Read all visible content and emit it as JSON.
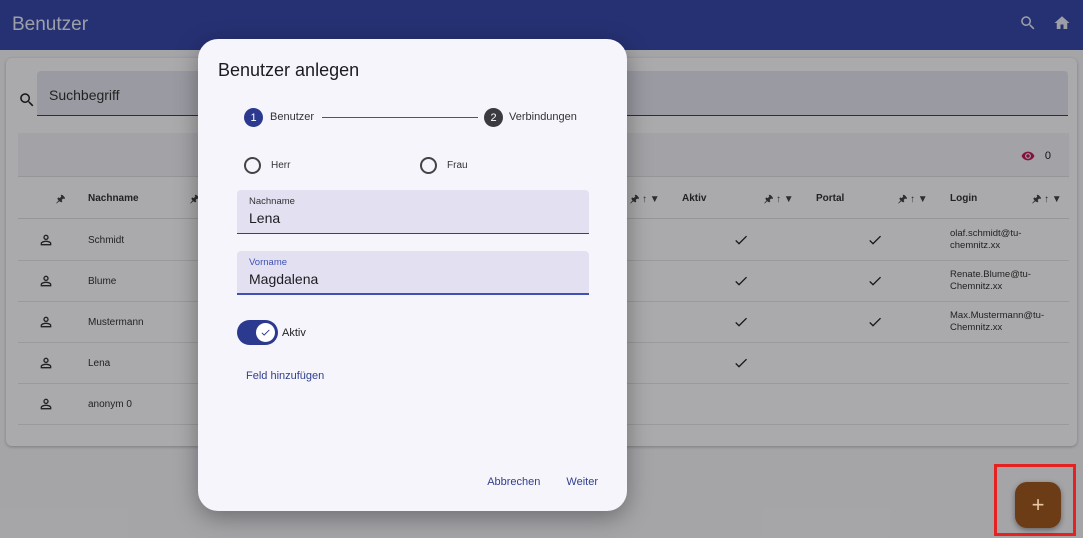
{
  "appbar": {
    "title": "Benutzer",
    "icons": [
      "search-icon",
      "home-icon"
    ]
  },
  "search": {
    "placeholder": "Suchbegriff"
  },
  "table": {
    "view_count": "0",
    "columns": {
      "nachname": "Nachname",
      "aktiv": "Aktiv",
      "portal": "Portal",
      "login": "Login"
    },
    "rows": [
      {
        "nachname": "Schmidt",
        "aktiv": true,
        "portal": true,
        "login_line1": "olaf.schmidt@tu-",
        "login_line2": "chemnitz.xx"
      },
      {
        "nachname": "Blume",
        "aktiv": true,
        "portal": true,
        "login_line1": "Renate.Blume@tu-",
        "login_line2": "Chemnitz.xx"
      },
      {
        "nachname": "Mustermann",
        "aktiv": true,
        "portal": true,
        "login_line1": "Max.Mustermann@tu-",
        "login_line2": "Chemnitz.xx"
      },
      {
        "nachname": "Lena",
        "aktiv": true,
        "portal": false,
        "login_line1": "",
        "login_line2": ""
      },
      {
        "nachname": "anonym 0",
        "aktiv": false,
        "portal": false,
        "login_line1": "",
        "login_line2": ""
      }
    ]
  },
  "dialog": {
    "title": "Benutzer anlegen",
    "steps": [
      {
        "number": "1",
        "label": "Benutzer",
        "active": true
      },
      {
        "number": "2",
        "label": "Verbindungen",
        "active": false
      }
    ],
    "radios": {
      "herr": "Herr",
      "frau": "Frau"
    },
    "nachname": {
      "label": "Nachname",
      "value": "Lena"
    },
    "vorname": {
      "label": "Vorname",
      "value": "Magdalena"
    },
    "toggle": {
      "label": "Aktiv",
      "on": true
    },
    "add_field_link": "Feld hinzufügen",
    "cancel_label": "Abbrechen",
    "next_label": "Weiter"
  },
  "fab": {
    "label": "+"
  },
  "colors": {
    "appbar": "#3949ab",
    "primary": "#2b3a8f",
    "fab": "#6b3c16",
    "highlight": "#e52222",
    "eye": "#c2185b"
  }
}
